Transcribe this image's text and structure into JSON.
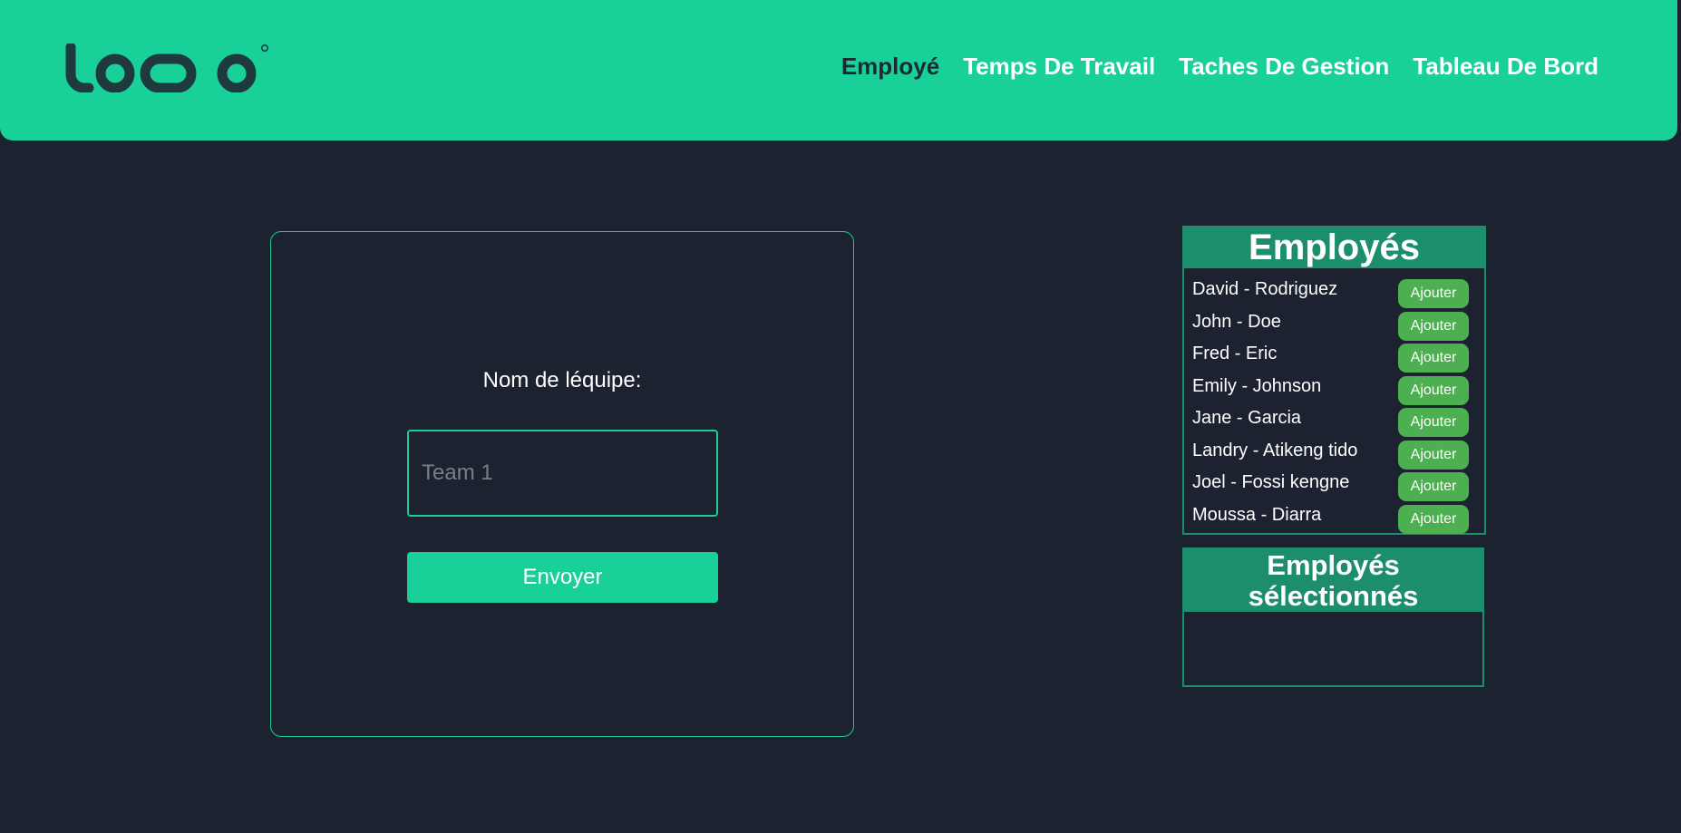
{
  "colors": {
    "accent": "#18d098",
    "background": "#1c2230",
    "panel_header": "#1c8e6c",
    "add_button": "#4caf50",
    "active_nav": "#1c2a34"
  },
  "header": {
    "logo_icon": "logoipsum-logo",
    "nav": [
      {
        "label": "Employé",
        "active": true
      },
      {
        "label": "Temps De Travail",
        "active": false
      },
      {
        "label": "Taches De Gestion",
        "active": false
      },
      {
        "label": "Tableau De Bord",
        "active": false
      }
    ]
  },
  "form": {
    "label": "Nom de léquipe:",
    "input_placeholder": "Team 1",
    "input_value": "",
    "submit_label": "Envoyer"
  },
  "employees": {
    "title": "Employés",
    "add_label": "Ajouter",
    "items": [
      {
        "name": "David - Rodriguez"
      },
      {
        "name": "John - Doe"
      },
      {
        "name": "Fred - Eric"
      },
      {
        "name": "Emily - Johnson"
      },
      {
        "name": "Jane - Garcia"
      },
      {
        "name": "Landry - Atikeng tido"
      },
      {
        "name": "Joel - Fossi kengne"
      },
      {
        "name": "Moussa - Diarra"
      }
    ]
  },
  "selected": {
    "title_line1": "Employés",
    "title_line2": "sélectionnés",
    "items": []
  }
}
